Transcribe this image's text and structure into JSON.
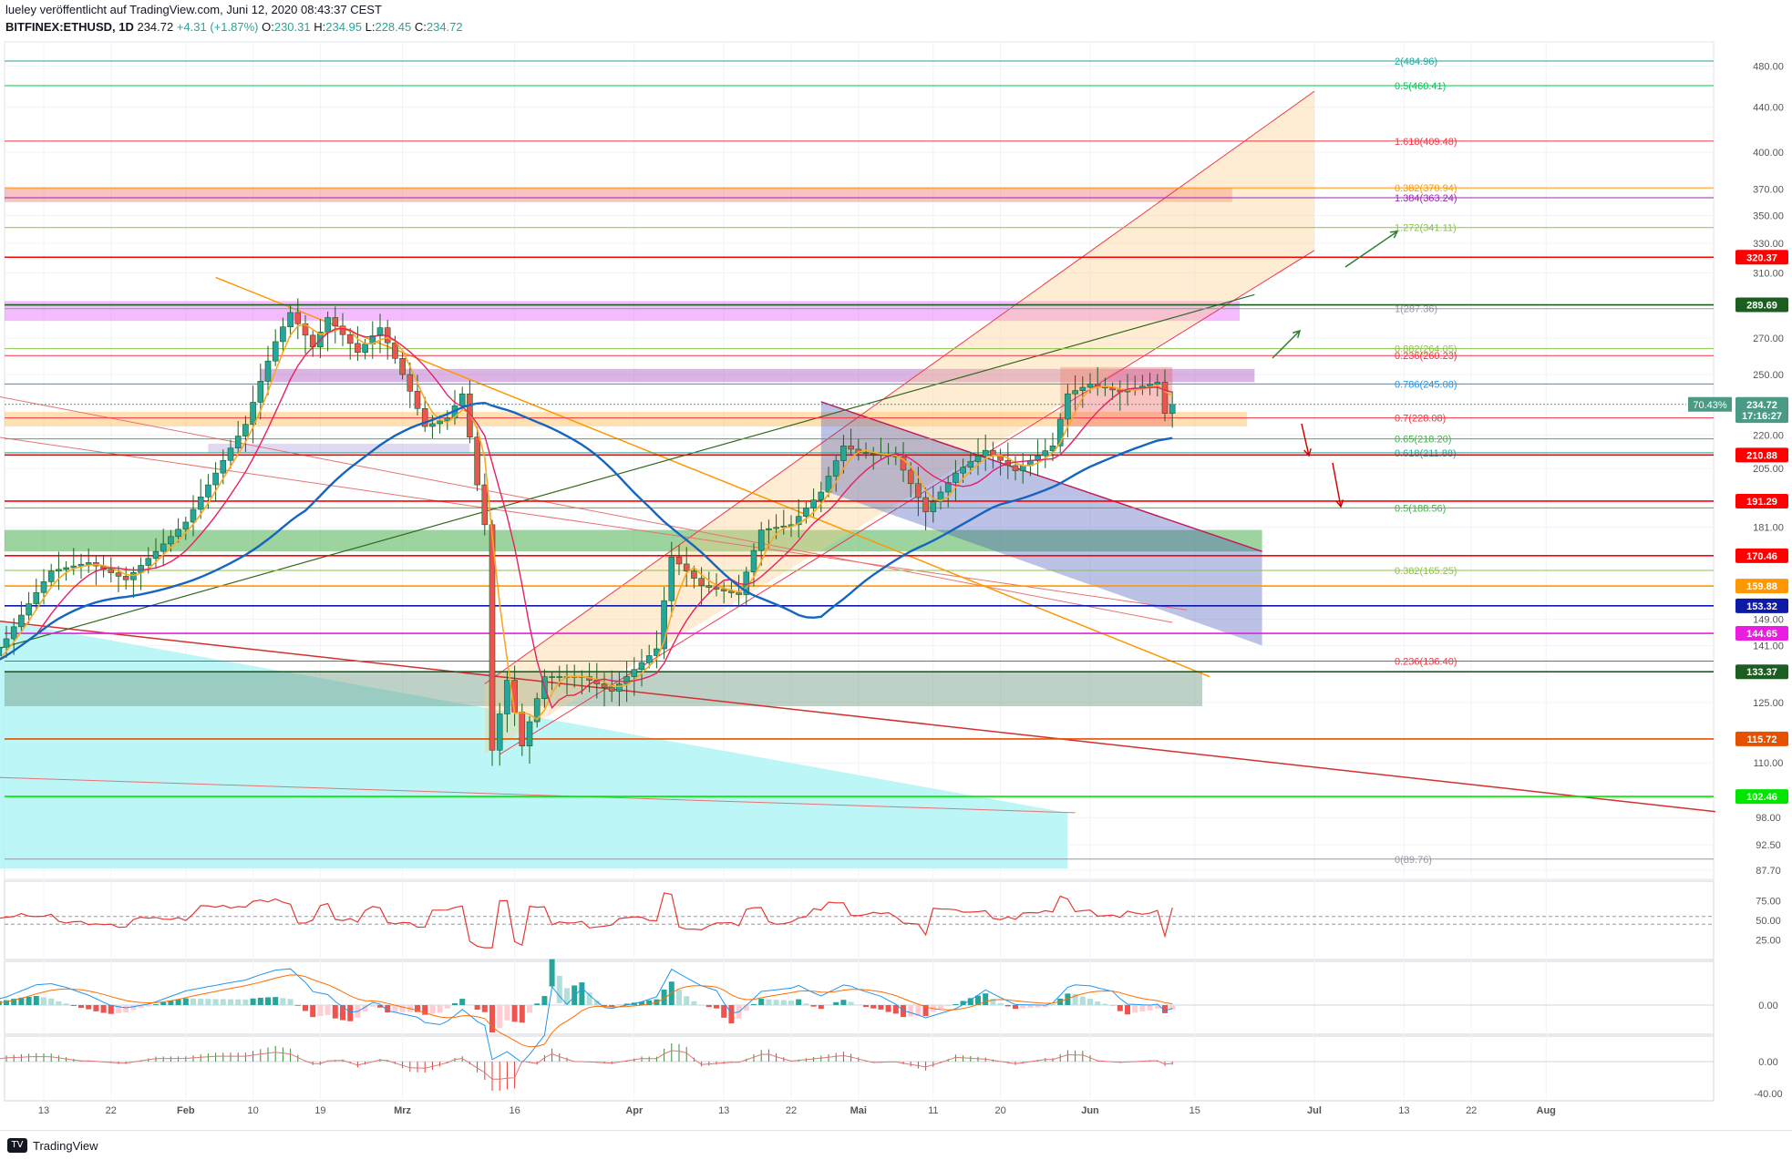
{
  "header": {
    "publisher_line": "lueley veröffentlicht auf TradingView.com, Juni 12, 2020 08:43:37 CEST",
    "symbol": "BITFINEX:ETHUSD, 1D",
    "last": "234.72",
    "change": "+4.31 (+1.87%)",
    "o_label": "O:",
    "o_val": "230.31",
    "h_label": "H:",
    "h_val": "234.95",
    "l_label": "L:",
    "l_val": "228.45",
    "c_label": "C:",
    "c_val": "234.72"
  },
  "footer": {
    "logo_text": "TradingView",
    "logo_mark": "TV"
  },
  "colors": {
    "up": "#26a69a",
    "down": "#ef5350",
    "grid": "#eef0f4",
    "text": "#131722"
  },
  "chart_data": {
    "type": "candlestick",
    "symbol": "BITFINEX:ETHUSD",
    "interval": "1D",
    "y_scale": "log",
    "ylim": [
      86,
      505
    ],
    "price_ticks": [
      480,
      440,
      400,
      370,
      350,
      330,
      310,
      270,
      250,
      220,
      205,
      181,
      149,
      141,
      125,
      110,
      98,
      92.5,
      87.7
    ],
    "price_tick_labels": [
      "480.00",
      "440.00",
      "400.00",
      "370.00",
      "350.00",
      "330.00",
      "310.00",
      "270.00",
      "250.00",
      "220.00",
      "205.00",
      "181.00",
      "149.00",
      "141.00",
      "125.00",
      "110.00",
      "98.00",
      "92.50",
      "87.70"
    ],
    "x_labels": [
      "13",
      "22",
      "Feb",
      "10",
      "19",
      "Mrz",
      "16",
      "Apr",
      "13",
      "22",
      "Mai",
      "11",
      "20",
      "Jun",
      "15",
      "Jul",
      "13",
      "22",
      "Aug"
    ],
    "x_label_dates": [
      "2020-01-13",
      "2020-01-22",
      "2020-02-01",
      "2020-02-10",
      "2020-02-19",
      "2020-03-01",
      "2020-03-16",
      "2020-04-01",
      "2020-04-13",
      "2020-04-22",
      "2020-05-01",
      "2020-05-11",
      "2020-05-20",
      "2020-06-01",
      "2020-06-15",
      "2020-07-01",
      "2020-07-13",
      "2020-07-22",
      "2020-08-01"
    ],
    "price_anchors": [
      [
        "2020-01-04",
        133
      ],
      [
        "2020-01-08",
        143
      ],
      [
        "2020-01-14",
        165
      ],
      [
        "2020-01-19",
        168
      ],
      [
        "2020-01-24",
        162
      ],
      [
        "2020-01-28",
        172
      ],
      [
        "2020-02-01",
        183
      ],
      [
        "2020-02-05",
        203
      ],
      [
        "2020-02-09",
        225
      ],
      [
        "2020-02-13",
        268
      ],
      [
        "2020-02-15",
        285
      ],
      [
        "2020-02-18",
        265
      ],
      [
        "2020-02-20",
        282
      ],
      [
        "2020-02-24",
        262
      ],
      [
        "2020-02-27",
        276
      ],
      [
        "2020-03-01",
        250
      ],
      [
        "2020-03-04",
        224
      ],
      [
        "2020-03-07",
        228
      ],
      [
        "2020-03-09",
        240
      ],
      [
        "2020-03-11",
        198
      ],
      [
        "2020-03-12",
        182
      ],
      [
        "2020-03-13",
        113
      ],
      [
        "2020-03-15",
        131
      ],
      [
        "2020-03-17",
        114
      ],
      [
        "2020-03-20",
        132
      ],
      [
        "2020-03-25",
        132
      ],
      [
        "2020-03-29",
        128
      ],
      [
        "2020-04-04",
        140
      ],
      [
        "2020-04-06",
        170
      ],
      [
        "2020-04-10",
        160
      ],
      [
        "2020-04-15",
        157
      ],
      [
        "2020-04-18",
        180
      ],
      [
        "2020-04-22",
        182
      ],
      [
        "2020-04-26",
        195
      ],
      [
        "2020-04-29",
        215
      ],
      [
        "2020-05-01",
        212
      ],
      [
        "2020-05-06",
        210
      ],
      [
        "2020-05-10",
        187
      ],
      [
        "2020-05-14",
        203
      ],
      [
        "2020-05-18",
        213
      ],
      [
        "2020-05-22",
        204
      ],
      [
        "2020-05-27",
        215
      ],
      [
        "2020-05-29",
        240
      ],
      [
        "2020-06-01",
        245
      ],
      [
        "2020-06-05",
        241
      ],
      [
        "2020-06-10",
        246
      ],
      [
        "2020-06-11",
        230.31
      ],
      [
        "2020-06-12",
        234.72
      ]
    ],
    "horizontal_levels": [
      {
        "value": 484.96,
        "label": "2(484.96)",
        "color": "#26a69a"
      },
      {
        "value": 460.41,
        "label": "0.5(460.41)",
        "color": "#00c853"
      },
      {
        "value": 409.48,
        "label": "1.618(409.48)",
        "color": "#f23645"
      },
      {
        "value": 370.94,
        "label": "0.382(370.94)",
        "color": "#ff9800"
      },
      {
        "value": 363.24,
        "label": "1.384(363.24)",
        "color": "#9c27b0"
      },
      {
        "value": 341.11,
        "label": "1.272(341.11)",
        "color": "#8bc34a"
      },
      {
        "value": 320.37,
        "label": "",
        "color": "#ff0000"
      },
      {
        "value": 287.36,
        "label": "1(287.36)",
        "color": "#9598a1"
      },
      {
        "value": 289.69,
        "label": "",
        "color": "#1b5e20"
      },
      {
        "value": 264.05,
        "label": "0.882(264.05)",
        "color": "#8bc34a"
      },
      {
        "value": 260.23,
        "label": "0.236(260.23)",
        "color": "#f23645"
      },
      {
        "value": 245.08,
        "label": "0.786(245.08)",
        "color": "#2196f3"
      },
      {
        "value": 228.08,
        "label": "0.7(228.08)",
        "color": "#f23645"
      },
      {
        "value": 218.2,
        "label": "0.65(218.20)",
        "color": "#4caf50"
      },
      {
        "value": 211.88,
        "label": "0.618(211.88)",
        "color": "#26a69a"
      },
      {
        "value": 210.88,
        "label": "",
        "color": "#ff0000"
      },
      {
        "value": 191.29,
        "label": "",
        "color": "#ff0000"
      },
      {
        "value": 188.56,
        "label": "0.5(188.56)",
        "color": "#4caf50"
      },
      {
        "value": 170.46,
        "label": "",
        "color": "#ff0000"
      },
      {
        "value": 165.25,
        "label": "0.382(165.25)",
        "color": "#8bc34a"
      },
      {
        "value": 159.88,
        "label": "",
        "color": "#ff9800"
      },
      {
        "value": 153.32,
        "label": "",
        "color": "#0d1aa6"
      },
      {
        "value": 144.65,
        "label": "",
        "color": "#e91ee0"
      },
      {
        "value": 136.4,
        "label": "0.236(136.40)",
        "color": "#f23645"
      },
      {
        "value": 133.37,
        "label": "",
        "color": "#1b5e20"
      },
      {
        "value": 115.72,
        "label": "",
        "color": "#e65100"
      },
      {
        "value": 102.46,
        "label": "",
        "color": "#00e600"
      },
      {
        "value": 89.76,
        "label": "0(89.76)",
        "color": "#9598a1"
      }
    ],
    "price_badges": [
      {
        "value": 320.37,
        "text": "320.37",
        "color": "#ff0000"
      },
      {
        "value": 289.69,
        "text": "289.69",
        "color": "#1b5e20"
      },
      {
        "value": 234.72,
        "text": "234.72",
        "color": "#4a9a86"
      },
      {
        "value": 229.2,
        "text": "17:16:27",
        "color": "#4a9a86"
      },
      {
        "value": 210.88,
        "text": "210.88",
        "color": "#ff0000"
      },
      {
        "value": 191.29,
        "text": "191.29",
        "color": "#ff0000"
      },
      {
        "value": 170.46,
        "text": "170.46",
        "color": "#ff0000"
      },
      {
        "value": 159.88,
        "text": "159.88",
        "color": "#ff9800"
      },
      {
        "value": 153.32,
        "text": "153.32",
        "color": "#0d1aa6"
      },
      {
        "value": 144.65,
        "text": "144.65",
        "color": "#e91ee0"
      },
      {
        "value": 133.37,
        "text": "133.37",
        "color": "#1b5e20"
      },
      {
        "value": 115.72,
        "text": "115.72",
        "color": "#e65100"
      },
      {
        "value": 102.46,
        "text": "102.46",
        "color": "#00e600"
      }
    ],
    "percent_badge": "70.43%",
    "rsi": {
      "ticks": [
        75,
        50,
        25
      ],
      "tick_labels": [
        "75.00",
        "50.00",
        "25.00"
      ],
      "upper": 55,
      "lower": 45,
      "last": 52
    },
    "macd": {
      "tick_labels": [
        "0.00"
      ]
    },
    "third_panel": {
      "tick_labels": [
        "0.00",
        "-40.00"
      ]
    }
  }
}
